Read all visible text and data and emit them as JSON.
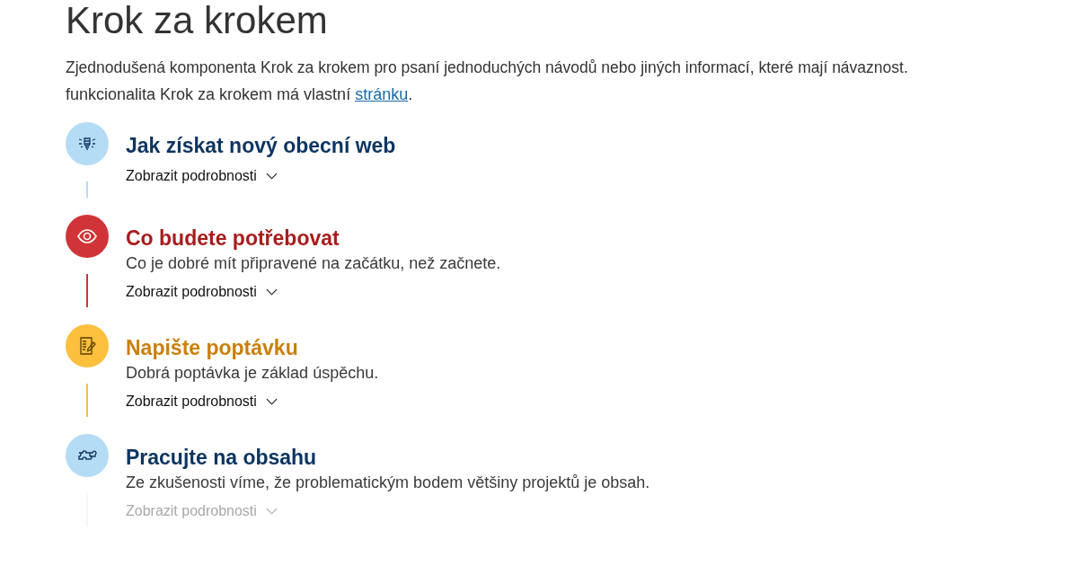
{
  "title": "Krok za krokem",
  "intro": {
    "text": "Zjednodušená komponenta Krok za krokem pro psaní jednoduchých návodů nebo jiných informací, které mají návaznost.",
    "text2": "funkcionalita Krok za krokem má vlastní",
    "link": "stránku",
    "end": "."
  },
  "steps": [
    {
      "kind": "info",
      "title": "Jak získat nový obecní web",
      "toggle": "Zobrazit podrobnosti",
      "faded": false
    },
    {
      "kind": "danger",
      "title": "Co budete potřebovat",
      "description": "Co je dobré mít připravené na začátku, než začnete.",
      "toggle": "Zobrazit podrobnosti",
      "faded": false
    },
    {
      "kind": "warning",
      "title": "Napište poptávku",
      "description": "Dobrá poptávka je základ úspěchu.",
      "toggle": "Zobrazit podrobnosti",
      "faded": false
    },
    {
      "kind": "info",
      "title": "Pracujte na obsahu",
      "description": "Ze zkušenosti víme, že problematickým bodem většiny projektů je obsah.",
      "toggle": "Zobrazit podrobnosti",
      "faded": true
    }
  ]
}
